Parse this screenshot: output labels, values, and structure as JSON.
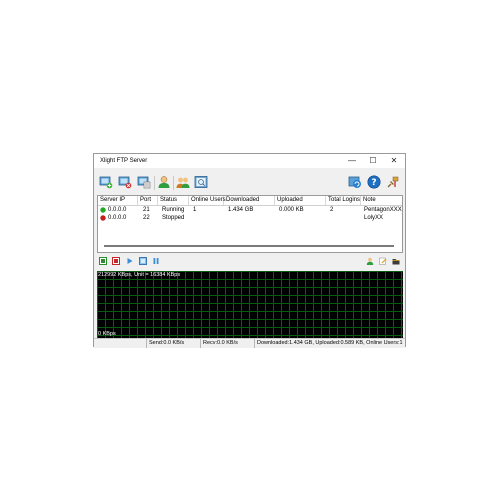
{
  "window": {
    "title": "Xlight FTP Server",
    "minimize_glyph": "—",
    "maximize_glyph": "☐",
    "close_glyph": "✕"
  },
  "toolbar": {
    "icons": [
      "add-server-icon",
      "delete-server-icon",
      "server-properties-icon",
      "user-icon",
      "users-group-icon",
      "view-log-icon",
      "update-icon",
      "help-icon",
      "settings-icon"
    ]
  },
  "table": {
    "columns": [
      "Server IP",
      "Port",
      "Status",
      "Online Users",
      "Downloaded",
      "Uploaded",
      "Total Logins",
      "Note"
    ],
    "rows": [
      {
        "ip": "0.0.0.0",
        "port": "21",
        "status": "Running",
        "online": "1",
        "downloaded": "1.434 GB",
        "uploaded": "0.000 KB",
        "logins": "2",
        "note": "PentagonXXX",
        "state_color": "#22aa22"
      },
      {
        "ip": "0.0.0.0",
        "port": "22",
        "status": "Stopped",
        "online": "",
        "downloaded": "",
        "uploaded": "",
        "logins": "",
        "note": "LolyXX",
        "state_color": "#c41e1e"
      }
    ]
  },
  "controls": {
    "icons": [
      "start-icon",
      "stop-icon",
      "play-icon",
      "window-icon",
      "pause-icon",
      "account-icon",
      "edit-icon",
      "folder-icon"
    ]
  },
  "graph": {
    "top_label": "212992 KBps, Unit = 16384 KBps",
    "bottom_label": "0 KBps"
  },
  "status": {
    "send": "Send:0.0 KB/s",
    "recv": "Recv:0.0 KB/s",
    "summary": "Downloaded:1.434 GB, Uploaded:0.589 KB, Online Users:1"
  }
}
